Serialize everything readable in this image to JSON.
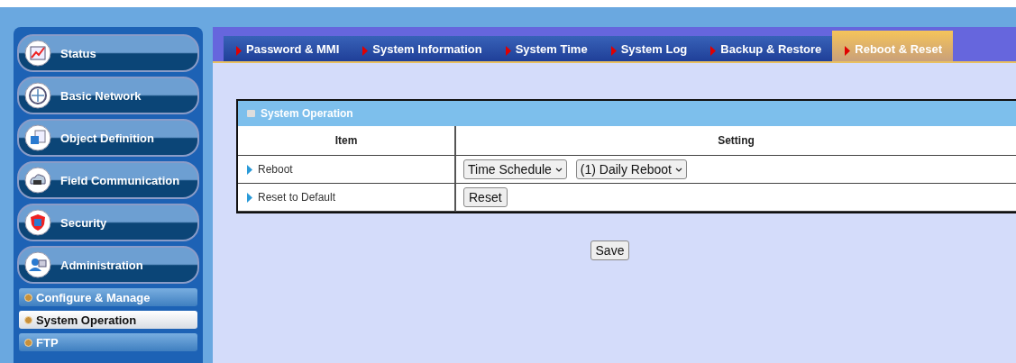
{
  "sidebar": {
    "items": [
      {
        "kind": "main",
        "label": "Status"
      },
      {
        "kind": "main",
        "label": "Basic Network"
      },
      {
        "kind": "main",
        "label": "Object Definition"
      },
      {
        "kind": "main",
        "label": "Field Communication"
      },
      {
        "kind": "main",
        "label": "Security"
      },
      {
        "kind": "main",
        "label": "Administration"
      },
      {
        "kind": "sub",
        "label": "Configure & Manage",
        "selected": false
      },
      {
        "kind": "sub",
        "label": "System Operation",
        "selected": true
      },
      {
        "kind": "sub",
        "label": "FTP",
        "selected": false
      }
    ]
  },
  "tabs": [
    {
      "label": "Password & MMI",
      "selected": false
    },
    {
      "label": "System Information",
      "selected": false
    },
    {
      "label": "System Time",
      "selected": false
    },
    {
      "label": "System Log",
      "selected": false
    },
    {
      "label": "Backup & Restore",
      "selected": false
    },
    {
      "label": "Reboot & Reset",
      "selected": true
    }
  ],
  "panel": {
    "title": "System Operation",
    "columns": [
      "Item",
      "Setting"
    ],
    "rows": [
      {
        "label": "Reboot",
        "controls": [
          {
            "kind": "select",
            "value": "Time Schedule"
          },
          {
            "kind": "select",
            "value": "(1) Daily Reboot"
          }
        ]
      },
      {
        "label": "Reset to Default",
        "controls": [
          {
            "kind": "button",
            "value": "Reset"
          }
        ]
      }
    ]
  },
  "save_button": "Save"
}
